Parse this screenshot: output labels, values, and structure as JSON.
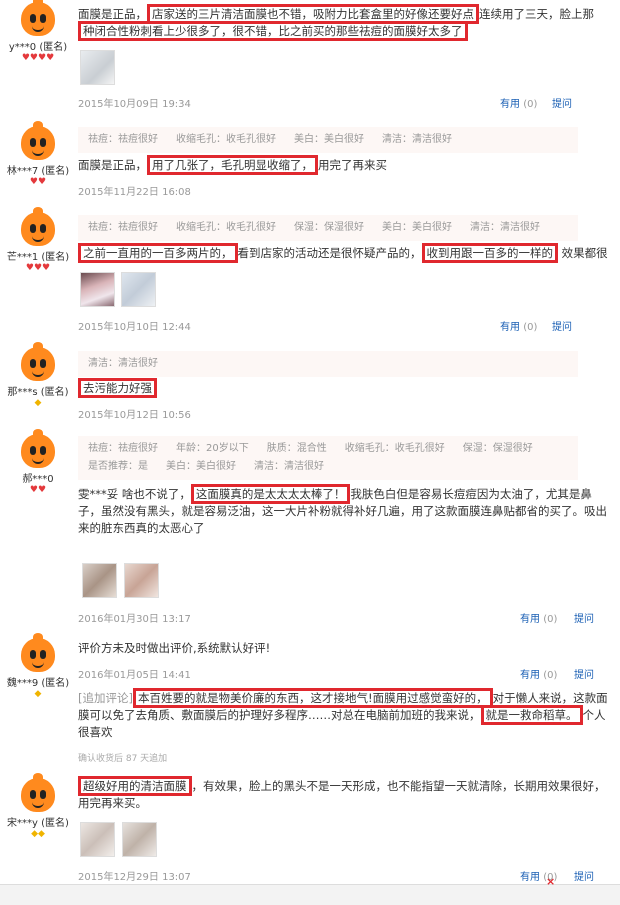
{
  "reviews": [
    {
      "user": "y***0 (匿名)",
      "level_icon": "red-hearts",
      "content_text": "面膜是正品，店家送的三片清洁面膜也不错，吸附力比套盒里的好像还要好点，连续用了三天，脸上那种闭合性粉刺看上少很多了，很不错，比之前买的那些祛痘的面膜好太多了",
      "highlights": [
        "店家送的三片清洁面膜也不错，吸附力比套盒里的好像还要好点",
        "种闭合性粉刺看上少很多了，很不错，比之前买的那些祛痘的面膜好太多了"
      ],
      "date": "2015年10月09日 19:34",
      "useful_label": "有用",
      "useful_count": "(0)",
      "ask_label": "提问"
    },
    {
      "user": "林***7 (匿名)",
      "tags": [
        "祛痘：祛痘很好",
        "收缩毛孔：收毛孔很好",
        "美白：美白很好",
        "清洁：清洁很好"
      ],
      "content_pre": "面膜是正品，",
      "highlight": "用了几张了，毛孔明显收缩了，",
      "content_post": "用完了再来买",
      "date": "2015年11月22日 16:08"
    },
    {
      "user": "芒***1 (匿名)",
      "tags": [
        "祛痘：祛痘很好",
        "收缩毛孔：收毛孔很好",
        "保湿：保湿很好",
        "美白：美白很好",
        "清洁：清洁很好"
      ],
      "highlight1": "之前一直用的一百多两片的，",
      "content_mid": "看到店家的活动还是很怀疑产品的，",
      "highlight2": "收到用跟一百多的一样的",
      "content_post": "效果都很",
      "date": "2015年10月10日 12:44",
      "useful_label": "有用",
      "useful_count": "(0)",
      "ask_label": "提问"
    },
    {
      "user": "那***s (匿名)",
      "tags": [
        "清洁：清洁很好"
      ],
      "highlight": "去污能力好强",
      "date": "2015年10月12日 10:56"
    },
    {
      "user": "郝***0",
      "tags_row1": [
        "祛痘：祛痘很好",
        "年龄：20岁以下",
        "肤质：混合性",
        "收缩毛孔：收毛孔很好",
        "保湿：保湿很好"
      ],
      "tags_row2": [
        "是否推荐：是",
        "美白：美白很好",
        "清洁：清洁很好"
      ],
      "content_pre": "雯***妥 啥也不说了，",
      "highlight": "这面膜真的是太太太太棒了！",
      "content_post": "我肤色白但是容易长痘痘因为太油了，尤其是鼻子，虽然没有黑头，就是容易泛油，这一大片补粉就得补好几遍，用了这款面膜连鼻贴都省的买了。吸出来的脏东西真的太恶心了",
      "date": "2016年01月30日 13:17",
      "useful_label": "有用",
      "useful_count": "(0)",
      "ask_label": "提问"
    },
    {
      "user": "魏***9 (匿名)",
      "content": "评价方未及时做出评价,系统默认好评!",
      "date": "2016年01月05日 14:41",
      "useful_label": "有用",
      "useful_count": "(0)",
      "ask_label": "提问",
      "append_label": "[追加评论]",
      "append_highlight1": "本百姓要的就是物美价廉的东西，这才接地气!面膜用过感觉蛮好的，",
      "append_mid": "对于懒人来说，这款面膜可以免了去角质、敷面膜后的护理好多程序……对总在电脑前加班的我来说，",
      "append_highlight2": "就是一救命稻草。",
      "append_post": "个人很喜欢",
      "confirm": "确认收货后 87 天追加"
    },
    {
      "user": "宋***y (匿名)",
      "highlight": "超级好用的清洁面膜",
      "content_post": "，有效果，脸上的黑头不是一天形成，也不能指望一天就清除，长期用效果很好，用完再来买。",
      "date": "2015年12月29日 13:07",
      "useful_label": "有用",
      "useful_count": "(0)",
      "ask_label": "提问"
    }
  ],
  "colors": {
    "highlight_border": "#e0282e",
    "link": "#1a5fb4",
    "tag_bg": "#fdf7f5",
    "avatar": "#ff8a1e"
  }
}
